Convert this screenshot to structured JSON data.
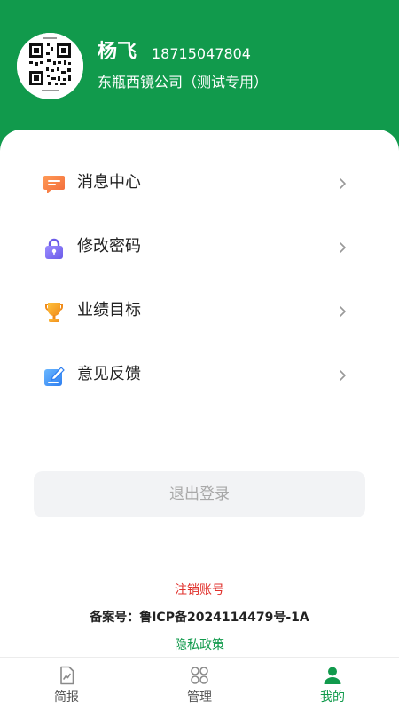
{
  "profile": {
    "name": "杨飞",
    "phone": "18715047804",
    "company": "东瓶西镜公司（测试专用）",
    "avatar_icon": "qr-code-icon"
  },
  "menu": {
    "items": [
      {
        "label": "消息中心",
        "icon": "message-icon",
        "icon_color": "#f57a3d"
      },
      {
        "label": "修改密码",
        "icon": "lock-icon",
        "icon_color": "#7b6cf0"
      },
      {
        "label": "业绩目标",
        "icon": "trophy-icon",
        "icon_color": "#f5a623"
      },
      {
        "label": "意见反馈",
        "icon": "feedback-icon",
        "icon_color": "#3d8ef5"
      }
    ],
    "chevron_icon": "chevron-right-icon"
  },
  "logout_label": "退出登录",
  "footer": {
    "delete_account": "注销账号",
    "icp": "备案号：鲁ICP备2024114479号-1A",
    "privacy": "隐私政策"
  },
  "tabbar": {
    "tabs": [
      {
        "label": "简报",
        "icon": "chart-report-icon",
        "active": false
      },
      {
        "label": "管理",
        "icon": "grid-apps-icon",
        "active": false
      },
      {
        "label": "我的",
        "icon": "person-icon",
        "active": true
      }
    ]
  },
  "colors": {
    "brand_green": "#119a4c",
    "danger_red": "#e0312c",
    "logout_bg": "#f2f3f5"
  }
}
